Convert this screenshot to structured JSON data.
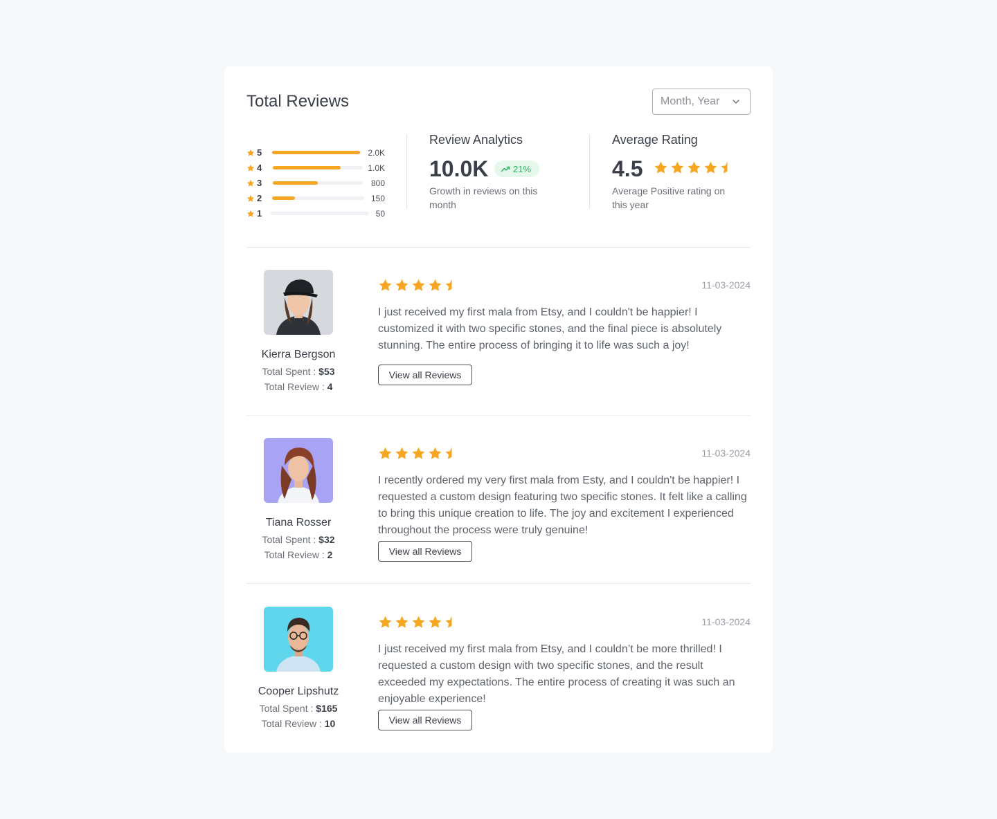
{
  "header": {
    "title": "Total Reviews",
    "period_placeholder": "Month, Year"
  },
  "distribution": [
    {
      "stars": "5",
      "count": "2.0K",
      "fraction": 0.98
    },
    {
      "stars": "4",
      "count": "1.0K",
      "fraction": 0.75
    },
    {
      "stars": "3",
      "count": "800",
      "fraction": 0.5
    },
    {
      "stars": "2",
      "count": "150",
      "fraction": 0.25
    },
    {
      "stars": "1",
      "count": "50",
      "fraction": 0.0
    }
  ],
  "analytics": {
    "heading": "Review Analytics",
    "value": "10.0K",
    "growth": "21%",
    "description": "Growth in reviews on this month"
  },
  "average": {
    "heading": "Average Rating",
    "value": "4.5",
    "rating": 4.5,
    "description": "Average Positive rating on this year"
  },
  "reviews": [
    {
      "name": "Kierra Bergson",
      "spent_label": "Total Spent : ",
      "spent": "$53",
      "count_label": "Total Review : ",
      "count": "4",
      "rating": 4.5,
      "date": "11-03-2024",
      "text": "I just received my first mala from Etsy, and I couldn't be happier! I customized it with two specific stones, and the final piece is absolutely stunning. The entire process of bringing it to life was such a joy!",
      "button": "View all Reviews",
      "avatar_bg": "#d5d8dc"
    },
    {
      "name": "Tiana Rosser",
      "spent_label": "Total Spent : ",
      "spent": "$32",
      "count_label": "Total Review : ",
      "count": "2",
      "rating": 4.5,
      "date": "11-03-2024",
      "text": "I recently ordered my very first mala from Esty, and I couldn't be happier! I requested a custom design featuring two specific stones. It felt like a calling to bring this unique creation to life. The joy and excitement I experienced throughout the process were truly genuine!",
      "button": "View all Reviews",
      "avatar_bg": "#a9a3f6"
    },
    {
      "name": "Cooper Lipshutz",
      "spent_label": "Total Spent : ",
      "spent": "$165",
      "count_label": "Total Review : ",
      "count": "10",
      "rating": 4.5,
      "date": "11-03-2024",
      "text": "I just received my first mala from Etsy, and I couldn’t be more thrilled! I requested a custom design with two specific stones, and the result exceeded my expectations. The entire process of creating it was such an enjoyable experience!",
      "button": "View all Reviews",
      "avatar_bg": "#5fd6ec"
    }
  ],
  "colors": {
    "star": "#f6a623",
    "growth": "#2bb55d",
    "growth_bg": "#e6f8ec"
  }
}
